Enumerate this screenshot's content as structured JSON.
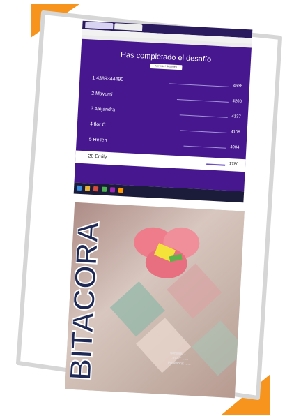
{
  "colors": {
    "accent_orange": "#f7941d",
    "quiz_purple": "#46178f",
    "card_border": "#d6d6d6"
  },
  "screenshot": {
    "title": "Has completado el desafío",
    "button_label": "Ver más / Resumen",
    "leaderboard": [
      {
        "rank_name": "1 4389344490",
        "score": "4638"
      },
      {
        "rank_name": "2 Mayumi",
        "score": "4208"
      },
      {
        "rank_name": "3 Alejandra",
        "score": "4137"
      },
      {
        "rank_name": "4 flor C.",
        "score": "4108"
      },
      {
        "rank_name": "5 Hellen",
        "score": "4004"
      },
      {
        "rank_name": "20 Emily",
        "score": "1780"
      }
    ],
    "bar_levels": [
      0.95,
      0.82,
      0.77,
      0.74,
      0.68,
      0.3
    ]
  },
  "photo": {
    "cover_word": "BITACORA",
    "caption_lines": [
      "Nombre: ......",
      "Grado: ......",
      "Profesora: ......"
    ]
  }
}
